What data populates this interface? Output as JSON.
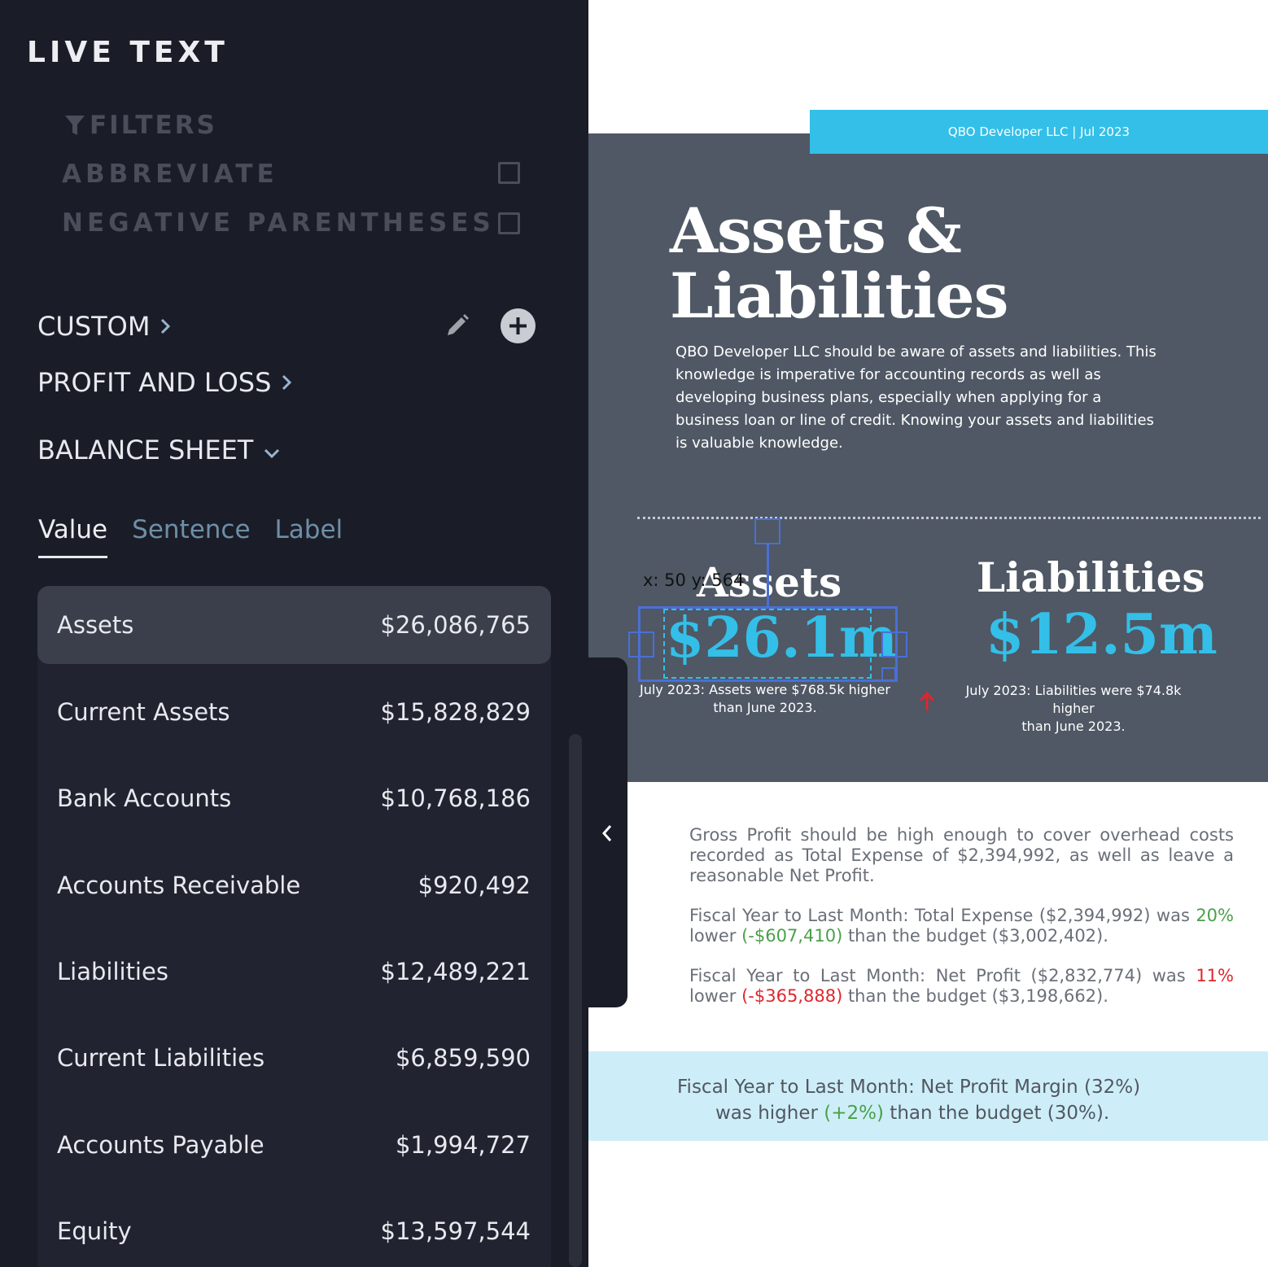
{
  "panel": {
    "title": "LIVE TEXT",
    "filters_label": "FILTERS",
    "options": [
      {
        "label": "ABBREVIATE",
        "checked": false
      },
      {
        "label": "NEGATIVE PARENTHESES",
        "checked": false
      }
    ],
    "sections": [
      {
        "label": "CUSTOM",
        "state": "collapsed"
      },
      {
        "label": "PROFIT AND LOSS",
        "state": "collapsed"
      },
      {
        "label": "BALANCE SHEET",
        "state": "expanded"
      }
    ],
    "tabs": [
      "Value",
      "Sentence",
      "Label"
    ],
    "active_tab": "Value",
    "rows": [
      {
        "label": "Assets",
        "value": "$26,086,765",
        "selected": true
      },
      {
        "label": "Current Assets",
        "value": "$15,828,829"
      },
      {
        "label": "Bank Accounts",
        "value": "$10,768,186"
      },
      {
        "label": "Accounts Receivable",
        "value": "$920,492"
      },
      {
        "label": "Liabilities",
        "value": "$12,489,221"
      },
      {
        "label": "Current Liabilities",
        "value": "$6,859,590"
      },
      {
        "label": "Accounts Payable",
        "value": "$1,994,727"
      },
      {
        "label": "Equity",
        "value": "$13,597,544"
      }
    ]
  },
  "document": {
    "banner": "QBO Developer LLC |  Jul 2023",
    "title_line1": "Assets &",
    "title_line2": "Liabilities",
    "description": "QBO Developer LLC should be aware of assets and liabilities. This knowledge is imperative for accounting records as well as developing business plans, especially when applying for a business loan or line of credit.  Knowing your assets and liabilities is valuable knowledge.",
    "coords_readout": "x: 50 y: 564",
    "assets": {
      "title": "Assets",
      "value": "$26.1m",
      "note_line1": "July 2023: Assets were $768.5k higher",
      "note_line2": "than June 2023."
    },
    "liabilities": {
      "title": "Liabilities",
      "value": "$12.5m",
      "note_line1": "July 2023: Liabilities were $74.8k higher",
      "note_line2": "than June 2023."
    },
    "para1": "Gross Profit should be high enough to cover overhead costs recorded as Total Expense of $2,394,992, as well as leave a reasonable Net Profit.",
    "para2": {
      "pre": "Fiscal Year to Last Month: Total Expense ($2,394,992) was ",
      "pct": "20%",
      "mid": " lower ",
      "delta": "(-$607,410)",
      "post": " than the budget ($3,002,402)."
    },
    "para3": {
      "pre": "Fiscal Year to Last Month: Net Profit ($2,832,774) was ",
      "pct": "11%",
      "mid": " lower ",
      "delta": "(-$365,888)",
      "post": " than the budget ($3,198,662)."
    },
    "callout": {
      "line1": "Fiscal Year to Last Month: Net Profit Margin (32%)",
      "line2_pre": "was higher ",
      "line2_delta": "(+2%)",
      "line2_post": " than the budget (30%)."
    }
  },
  "colors": {
    "accent": "#33bfe8",
    "positive": "#4aa04a",
    "negative": "#e0262d",
    "panel_bg": "#1a1d27"
  }
}
